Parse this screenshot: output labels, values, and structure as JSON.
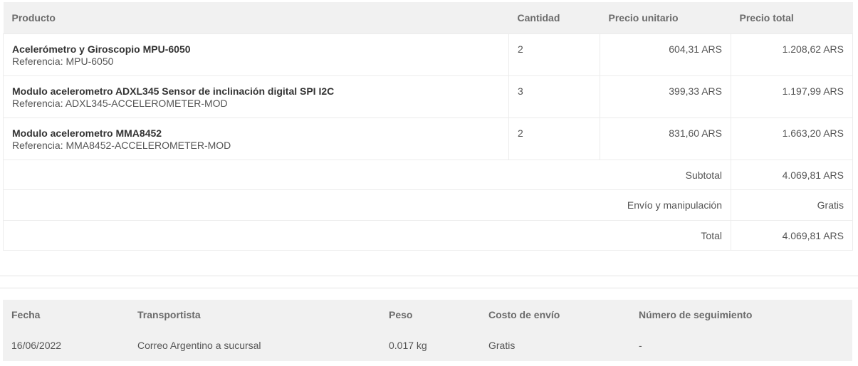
{
  "products_table": {
    "headers": [
      "Producto",
      "Cantidad",
      "Precio unitario",
      "Precio total"
    ],
    "rows": [
      {
        "name": "Acelerómetro y Giroscopio MPU-6050",
        "reference": "Referencia: MPU-6050",
        "quantity": "2",
        "unit_price": "604,31 ARS",
        "total_price": "1.208,62 ARS"
      },
      {
        "name": "Modulo acelerometro ADXL345 Sensor de inclinación digital SPI I2C",
        "reference": "Referencia: ADXL345-ACCELEROMETER-MOD",
        "quantity": "3",
        "unit_price": "399,33 ARS",
        "total_price": "1.197,99 ARS"
      },
      {
        "name": "Modulo acelerometro MMA8452",
        "reference": "Referencia: MMA8452-ACCELEROMETER-MOD",
        "quantity": "2",
        "unit_price": "831,60 ARS",
        "total_price": "1.663,20 ARS"
      }
    ],
    "summary": [
      {
        "label": "Subtotal",
        "value": "4.069,81 ARS"
      },
      {
        "label": "Envío y manipulación",
        "value": "Gratis"
      },
      {
        "label": "Total",
        "value": "4.069,81 ARS"
      }
    ]
  },
  "shipping_table": {
    "headers": [
      "Fecha",
      "Transportista",
      "Peso",
      "Costo de envío",
      "Número de seguimiento"
    ],
    "row": {
      "date": "16/06/2022",
      "carrier": "Correo Argentino a sucursal",
      "weight": "0.017 kg",
      "cost": "Gratis",
      "tracking": "-"
    }
  }
}
